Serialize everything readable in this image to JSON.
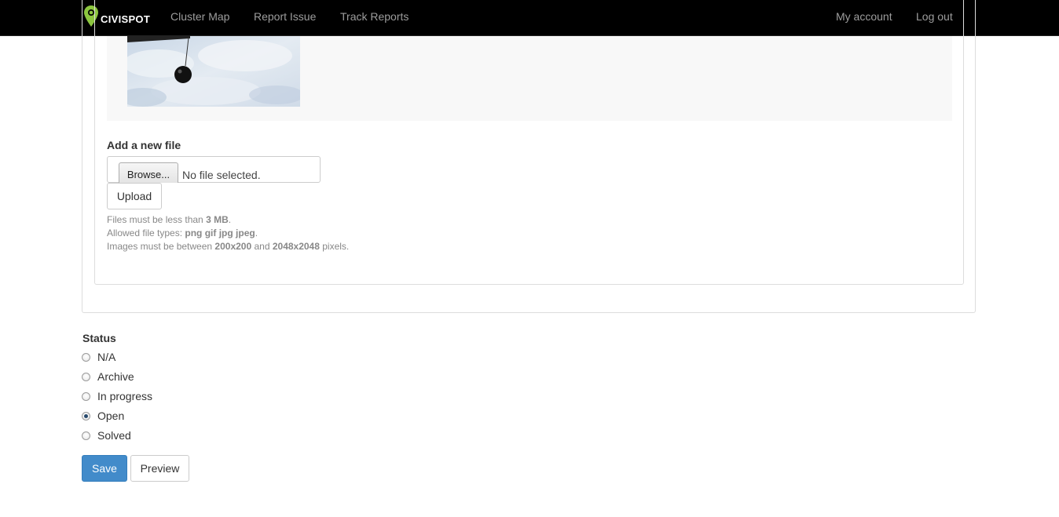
{
  "navbar": {
    "logo_text": "CIVISPOT",
    "links": [
      "Cluster Map",
      "Report Issue",
      "Track Reports"
    ],
    "right_links": [
      "My account",
      "Log out"
    ]
  },
  "upload": {
    "label": "Add a new file",
    "browse_label": "Browse...",
    "file_status": "No file selected.",
    "upload_label": "Upload",
    "help_size_prefix": "Files must be less than ",
    "help_size_value": "3 MB",
    "help_size_suffix": ".",
    "help_types_prefix": "Allowed file types: ",
    "help_types_value": "png gif jpg jpeg",
    "help_types_suffix": ".",
    "help_dims_prefix": "Images must be between ",
    "help_dims_min": "200x200",
    "help_dims_and": " and ",
    "help_dims_max": "2048x2048",
    "help_dims_suffix": " pixels."
  },
  "status": {
    "label": "Status",
    "options": [
      "N/A",
      "Archive",
      "In progress",
      "Open",
      "Solved"
    ],
    "selected": "Open"
  },
  "actions": {
    "save_label": "Save",
    "preview_label": "Preview"
  },
  "colors": {
    "navbar_bg": "#000000",
    "logo_accent": "#8cc63f",
    "primary": "#428bca"
  }
}
